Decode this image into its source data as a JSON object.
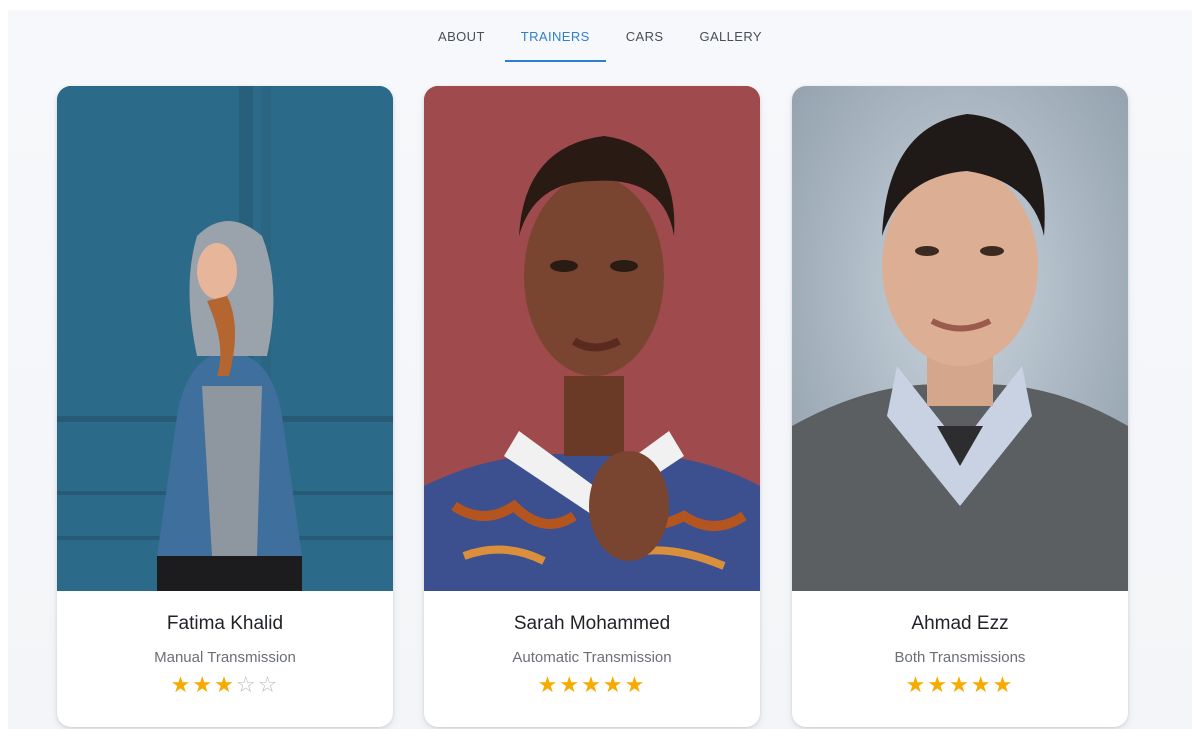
{
  "nav": {
    "tabs": [
      {
        "label": "ABOUT",
        "active": false
      },
      {
        "label": "TRAINERS",
        "active": true
      },
      {
        "label": "CARS",
        "active": false
      },
      {
        "label": "GALLERY",
        "active": false
      }
    ]
  },
  "colors": {
    "accent": "#2f7fd0",
    "star": "#f6ab00",
    "star_empty": "#b9bcc2"
  },
  "trainers": [
    {
      "name": "Fatima Khalid",
      "specialty": "Manual Transmission",
      "rating": 3,
      "rating_max": 5
    },
    {
      "name": "Sarah Mohammed",
      "specialty": "Automatic Transmission",
      "rating": 5,
      "rating_max": 5
    },
    {
      "name": "Ahmad Ezz",
      "specialty": "Both Transmissions",
      "rating": 5,
      "rating_max": 5
    }
  ]
}
